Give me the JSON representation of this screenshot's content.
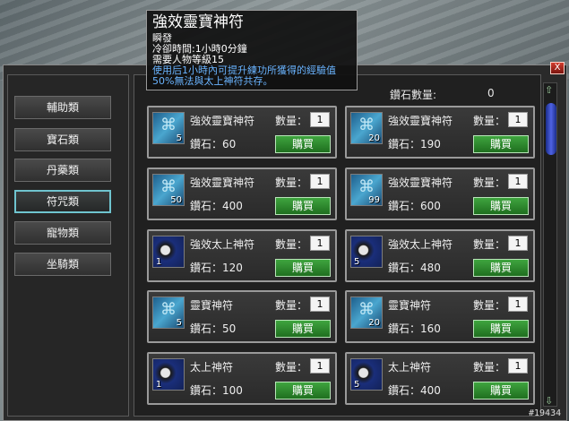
{
  "tooltip": {
    "title": "強效靈寶神符",
    "line1": "瞬發",
    "line2": "冷卻時間:1小時0分鐘",
    "line3": "需要人物等級15",
    "desc1": "使用后1小時內可提升練功所獲得的經驗值",
    "desc2": "50%無法與太上神符共存。"
  },
  "categories": [
    "輔助類",
    "寶石類",
    "丹藥類",
    "符咒類",
    "寵物類",
    "坐騎類"
  ],
  "active_category": "符咒類",
  "diamond_label": "鑽石數量:",
  "diamond_value": "0",
  "qty_label": "數量：",
  "buy_label": "購買",
  "close_label": "X",
  "watermark": "#19434",
  "items": [
    {
      "name": "強效靈寶神符",
      "price": "鑽石：60",
      "stack": "5",
      "qty": "1",
      "icon": "talisman-blue-icon"
    },
    {
      "name": "強效靈寶神符",
      "price": "鑽石：190",
      "stack": "20",
      "qty": "1",
      "icon": "talisman-blue-icon"
    },
    {
      "name": "強效靈寶神符",
      "price": "鑽石：400",
      "stack": "50",
      "qty": "1",
      "icon": "talisman-blue-icon"
    },
    {
      "name": "強效靈寶神符",
      "price": "鑽石：600",
      "stack": "99",
      "qty": "1",
      "icon": "talisman-blue-icon"
    },
    {
      "name": "強效太上神符",
      "price": "鑽石：120",
      "stack": "1",
      "qty": "1",
      "icon": "yinyang-book-icon"
    },
    {
      "name": "強效太上神符",
      "price": "鑽石：480",
      "stack": "5",
      "qty": "1",
      "icon": "yinyang-book-icon"
    },
    {
      "name": "靈寶神符",
      "price": "鑽石：50",
      "stack": "5",
      "qty": "1",
      "icon": "talisman-blue-icon"
    },
    {
      "name": "靈寶神符",
      "price": "鑽石：160",
      "stack": "20",
      "qty": "1",
      "icon": "talisman-blue-icon"
    },
    {
      "name": "太上神符",
      "price": "鑽石：100",
      "stack": "1",
      "qty": "1",
      "icon": "yinyang-book-icon"
    },
    {
      "name": "太上神符",
      "price": "鑽石：400",
      "stack": "5",
      "qty": "1",
      "icon": "yinyang-book-icon"
    }
  ]
}
